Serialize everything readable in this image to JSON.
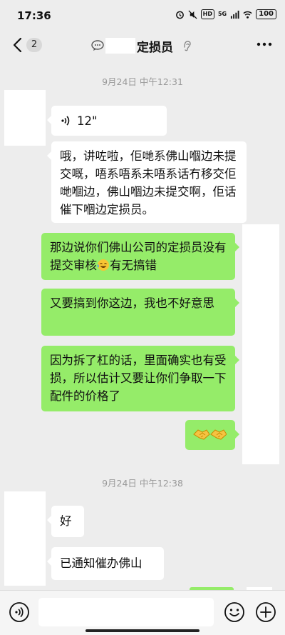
{
  "status_bar": {
    "time": "17:36",
    "battery": "100",
    "network": "5G",
    "hd": "HD"
  },
  "nav": {
    "unread_count": "2",
    "title": "定损员"
  },
  "timestamps": [
    "9月24日 中午12:31",
    "9月24日 中午12:38"
  ],
  "messages": {
    "voice_duration": "12\"",
    "in_1": "哦，讲咗啦，佢哋系佛山嗰边未提交嘅，唔系唔系未唔系话冇移交佢哋嗰边，佛山嗰边未提交啊，佢话催下嗰边定损员。",
    "out_1_part1": "那边说你们佛山公司的定损员没有提交审核",
    "out_1_part2": "有无搞错",
    "out_2": "又要搞到你这边，我也不好意思",
    "out_3": "因为拆了杠的话，里面确实也有受损，所以估计又要让你们争取一下配件的价格了",
    "in_2": "好",
    "in_3": "已通知催办佛山"
  },
  "colors": {
    "outgoing_bubble": "#95ec69",
    "incoming_bubble": "#ffffff",
    "background": "#ededed"
  }
}
